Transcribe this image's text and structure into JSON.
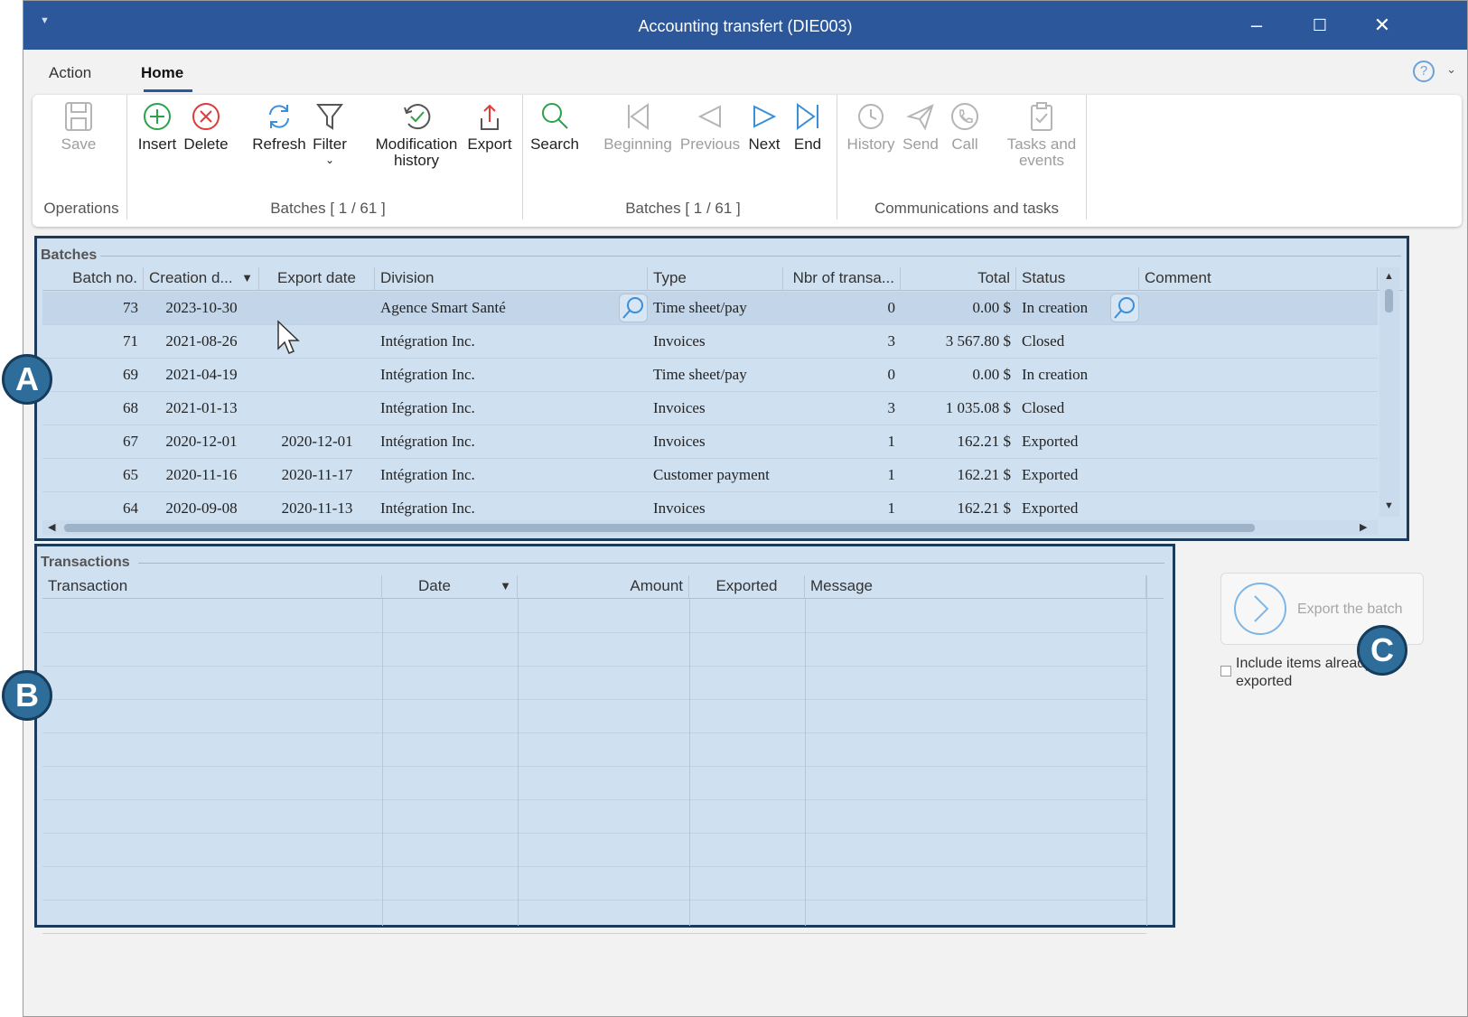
{
  "window": {
    "title": "Accounting transfert (DIE003)"
  },
  "menu": {
    "tabs": [
      {
        "label": "Action"
      },
      {
        "label": "Home"
      }
    ]
  },
  "ribbon": {
    "save": "Save",
    "insert": "Insert",
    "delete": "Delete",
    "refresh": "Refresh",
    "filter": "Filter",
    "modification_history_1": "Modification",
    "modification_history_2": "history",
    "export": "Export",
    "search": "Search",
    "beginning": "Beginning",
    "previous": "Previous",
    "next": "Next",
    "end": "End",
    "history": "History",
    "send": "Send",
    "call": "Call",
    "tasks_1": "Tasks and",
    "tasks_2": "events",
    "groups": {
      "operations": "Operations",
      "batches1": "Batches [ 1 / 61 ]",
      "batches2": "Batches [ 1 / 61 ]",
      "comms": "Communications and tasks"
    }
  },
  "batches": {
    "title": "Batches",
    "columns": [
      "Batch no.",
      "Creation d...",
      "Export date",
      "Division",
      "Type",
      "Nbr of transa...",
      "Total",
      "Status",
      "Comment"
    ],
    "rows": [
      {
        "no": "73",
        "created": "2023-10-30",
        "exported": "",
        "division": "Agence Smart Santé",
        "type": "Time sheet/pay",
        "count": "0",
        "total": "0.00 $",
        "status": "In creation",
        "comment": ""
      },
      {
        "no": "71",
        "created": "2021-08-26",
        "exported": "",
        "division": "Intégration Inc.",
        "type": "Invoices",
        "count": "3",
        "total": "3 567.80 $",
        "status": "Closed",
        "comment": ""
      },
      {
        "no": "69",
        "created": "2021-04-19",
        "exported": "",
        "division": "Intégration Inc.",
        "type": "Time sheet/pay",
        "count": "0",
        "total": "0.00 $",
        "status": "In creation",
        "comment": ""
      },
      {
        "no": "68",
        "created": "2021-01-13",
        "exported": "",
        "division": "Intégration Inc.",
        "type": "Invoices",
        "count": "3",
        "total": "1 035.08 $",
        "status": "Closed",
        "comment": ""
      },
      {
        "no": "67",
        "created": "2020-12-01",
        "exported": "2020-12-01",
        "division": "Intégration Inc.",
        "type": "Invoices",
        "count": "1",
        "total": "162.21 $",
        "status": "Exported",
        "comment": ""
      },
      {
        "no": "65",
        "created": "2020-11-16",
        "exported": "2020-11-17",
        "division": "Intégration Inc.",
        "type": "Customer payment",
        "count": "1",
        "total": "162.21 $",
        "status": "Exported",
        "comment": ""
      },
      {
        "no": "64",
        "created": "2020-09-08",
        "exported": "2020-11-13",
        "division": "Intégration Inc.",
        "type": "Invoices",
        "count": "1",
        "total": "162.21 $",
        "status": "Exported",
        "comment": ""
      }
    ]
  },
  "transactions": {
    "title": "Transactions",
    "columns": [
      "Transaction",
      "Date",
      "Amount",
      "Exported",
      "Message"
    ]
  },
  "side": {
    "export_batch": "Export the batch",
    "include_exported": "Include items already exported"
  },
  "badges": {
    "a": "A",
    "b": "B",
    "c": "C"
  }
}
